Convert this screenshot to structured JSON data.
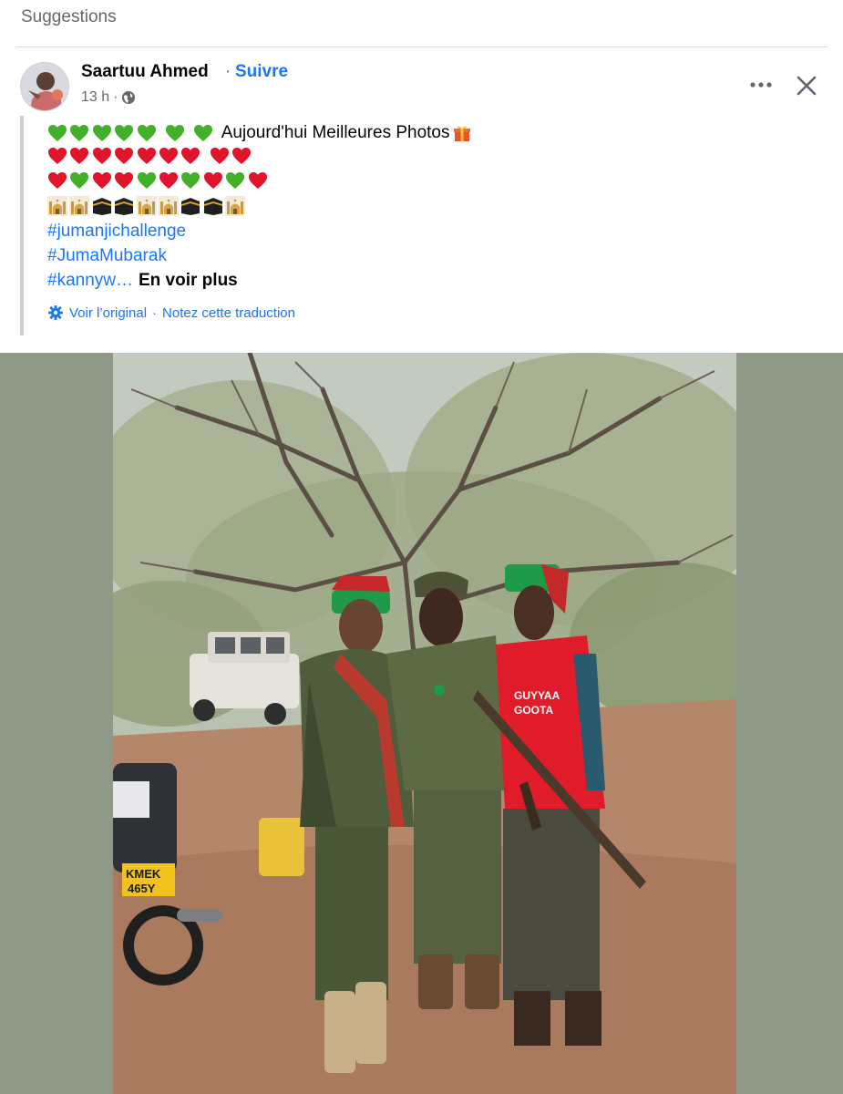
{
  "section_title": "Suggestions",
  "post": {
    "author": "Saartuu Ahmed",
    "separator": "·",
    "follow_label": "Suivre",
    "time": "13 h",
    "time_separator": "·",
    "privacy_icon": "globe-icon",
    "more_icon": "more-horizontal-icon",
    "close_icon": "close-icon",
    "text": {
      "line1_emojis": [
        "green-heart",
        "green-heart",
        "green-heart",
        "green-heart",
        "green-heart",
        "green-heart",
        "green-heart"
      ],
      "line1_text": "Aujourd'hui Meilleures Photos",
      "line1_trailing_emoji": "gift-icon",
      "line2_emojis": [
        "red-heart",
        "red-heart",
        "red-heart",
        "red-heart",
        "red-heart",
        "red-heart",
        "red-heart",
        "red-heart",
        "red-heart"
      ],
      "line3_emojis": [
        "red-heart",
        "green-heart",
        "red-heart",
        "red-heart",
        "green-heart",
        "red-heart",
        "green-heart",
        "red-heart",
        "green-heart",
        "red-heart"
      ],
      "line4_emojis": [
        "mosque",
        "mosque",
        "kaaba",
        "kaaba",
        "mosque",
        "mosque",
        "kaaba",
        "kaaba",
        "mosque"
      ],
      "hashtags": [
        "#jumanjichallenge",
        "#JumaMubarak",
        "#kannyw…"
      ],
      "see_more": "En voir plus"
    },
    "translation": {
      "icon": "gear-icon",
      "view_original": "Voir l’original",
      "separator": "·",
      "rate_translation": "Notez cette traduction"
    },
    "photo": {
      "plate_text_line1": "KMEK",
      "plate_text_line2": "465Y",
      "shirt_text_line1": "GUYYAA",
      "shirt_text_line2": "GOOTA"
    }
  },
  "colors": {
    "link_blue": "#1877f2",
    "secondary_text": "#65676b",
    "photo_side_background": "#8e9a87",
    "quote_border": "#ccd0d5"
  }
}
